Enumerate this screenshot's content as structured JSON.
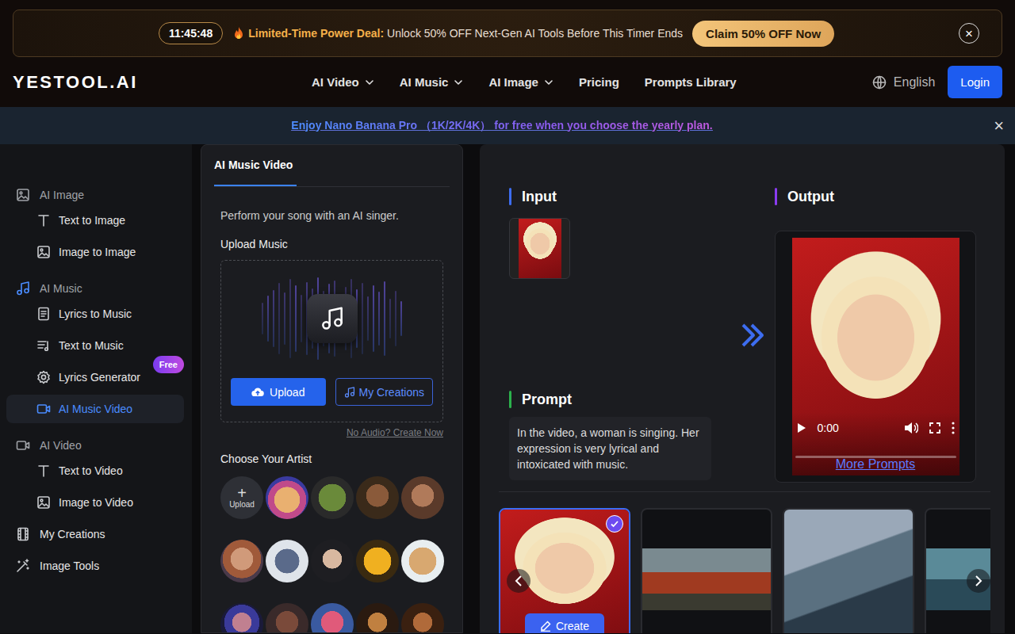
{
  "promo": {
    "timer": "11:45:48",
    "title": "Limited-Time Power Deal:",
    "text": "Unlock 50% OFF Next-Gen AI Tools Before This Timer Ends",
    "button": "Claim 50% OFF Now",
    "close": "×"
  },
  "header": {
    "logo": "YESTOOL.AI",
    "nav": [
      {
        "label": "AI Video",
        "dropdown": true
      },
      {
        "label": "AI Music",
        "dropdown": true
      },
      {
        "label": "AI Image",
        "dropdown": true
      },
      {
        "label": "Pricing",
        "dropdown": false
      },
      {
        "label": "Prompts Library",
        "dropdown": false
      }
    ],
    "language": "English",
    "login": "Login"
  },
  "notice": {
    "text": "Enjoy Nano Banana Pro （1K/2K/4K） for free when you choose the yearly plan.",
    "close": "×"
  },
  "sidebar": {
    "sections": [
      {
        "label": "AI Image",
        "active": false,
        "items": [
          {
            "label": "Text to Image",
            "selected": false
          },
          {
            "label": "Image to Image",
            "selected": false
          }
        ]
      },
      {
        "label": "AI Music",
        "active": true,
        "items": [
          {
            "label": "Lyrics to Music",
            "selected": false
          },
          {
            "label": "Text to Music",
            "selected": false
          },
          {
            "label": "Lyrics Generator",
            "selected": false,
            "badge": "Free"
          },
          {
            "label": "AI Music Video",
            "selected": true
          }
        ]
      },
      {
        "label": "AI Video",
        "active": false,
        "items": [
          {
            "label": "Text to Video",
            "selected": false
          },
          {
            "label": "Image to Video",
            "selected": false
          }
        ]
      }
    ],
    "links": [
      {
        "label": "My Creations",
        "selected": false
      },
      {
        "label": "Image Tools",
        "selected": false
      }
    ]
  },
  "tool": {
    "tabs": [
      {
        "label": "AI Music Video",
        "selected": true
      }
    ],
    "description": "Perform your song with an AI singer.",
    "upload_label": "Upload Music",
    "upload_button": "Upload",
    "creations_button": "My Creations",
    "create_link": "No Audio? Create Now",
    "artists_label": "Choose Your Artist",
    "artist_upload": {
      "icon": "+",
      "label": "Upload"
    },
    "artists": [
      {
        "selected": false
      },
      {
        "selected": false
      },
      {
        "selected": false
      },
      {
        "selected": false
      },
      {
        "selected": false
      },
      {
        "selected": false
      },
      {
        "selected": false
      },
      {
        "selected": false
      },
      {
        "selected": false
      },
      {
        "selected": false
      },
      {
        "selected": false
      },
      {
        "selected": false
      },
      {
        "selected": false
      },
      {
        "selected": false
      }
    ]
  },
  "showcase": {
    "input_title": "Input",
    "prompt_title": "Prompt",
    "prompt": "In the video, a woman is singing. Her expression is very lyrical and intoxicated with music.",
    "output_title": "Output",
    "player": {
      "time": "0:00",
      "level": 0
    },
    "more_prompts": "More Prompts",
    "examples": [
      {
        "selected": true
      },
      {
        "selected": false
      },
      {
        "selected": false
      },
      {
        "selected": false
      }
    ],
    "create_button": "Create"
  }
}
